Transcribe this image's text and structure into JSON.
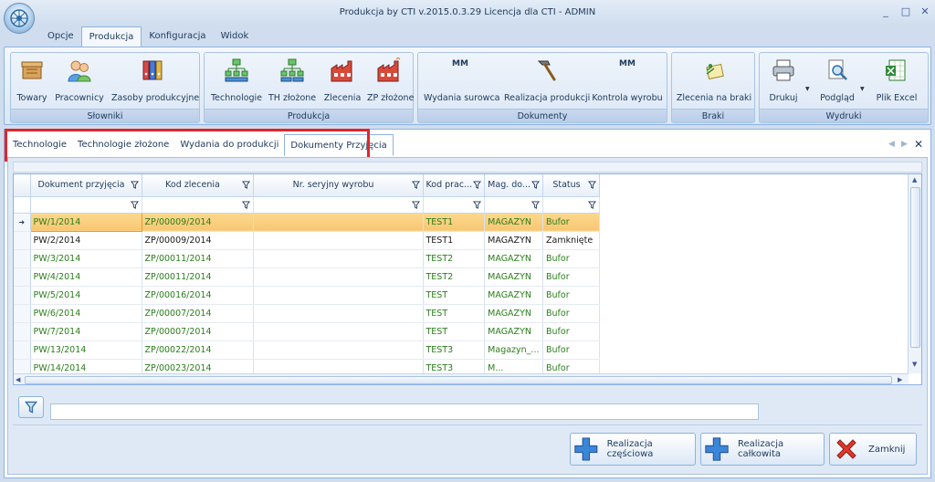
{
  "window": {
    "title": "Produkcja by CTI v.2015.0.3.29 Licencja dla CTI - ADMIN",
    "minimize_glyph": "_",
    "maximize_glyph": "□",
    "close_glyph": "✕"
  },
  "menu": {
    "tabs": [
      {
        "label": "Opcje"
      },
      {
        "label": "Produkcja"
      },
      {
        "label": "Konfiguracja"
      },
      {
        "label": "Widok"
      }
    ],
    "active": "Produkcja"
  },
  "ribbon": {
    "groups": [
      {
        "label": "Słowniki",
        "buttons": [
          {
            "label": "Towary",
            "icon": "box-icon"
          },
          {
            "label": "Pracownicy",
            "icon": "people-icon"
          },
          {
            "label": "Zasoby produkcyjne",
            "icon": "binders-icon"
          }
        ]
      },
      {
        "label": "Produkcja",
        "buttons": [
          {
            "label": "Technologie",
            "icon": "hierarchy-icon"
          },
          {
            "label": "TH złożone",
            "icon": "hierarchy-complex-icon"
          },
          {
            "label": "Zlecenia",
            "icon": "factory-icon"
          },
          {
            "label": "ZP złożone",
            "icon": "factory-complex-icon"
          }
        ]
      },
      {
        "label": "Dokumenty",
        "buttons": [
          {
            "label": "Wydania surowca",
            "icon": "mm-doc-icon"
          },
          {
            "label": "Realizacja produkcji",
            "icon": "hammer-icon"
          },
          {
            "label": "Kontrola wyrobu",
            "icon": "mm-doc-icon"
          }
        ]
      },
      {
        "label": "Braki",
        "buttons": [
          {
            "label": "Zlecenia na braki",
            "icon": "notes-icon"
          }
        ]
      },
      {
        "label": "Wydruki",
        "buttons": [
          {
            "label": "Drukuj",
            "icon": "printer-icon"
          },
          {
            "label": "Podgląd",
            "icon": "preview-icon"
          },
          {
            "label": "Plik Excel",
            "icon": "excel-icon"
          }
        ]
      }
    ],
    "mm_text": "MM"
  },
  "doc_tabs": {
    "tabs": [
      "Technologie",
      "Technologie złożone",
      "Wydania do produkcji",
      "Dokumenty Przyjęcia"
    ],
    "active": "Dokumenty Przyjęcia",
    "close_glyph": "✕",
    "highlight_color": "#e0262b"
  },
  "grid": {
    "columns": [
      "Dokument przyjęcia",
      "Kod zlecenia",
      "Nr. seryjny wyrobu",
      "Kod prac...",
      "Mag. do...",
      "Status"
    ],
    "rows": [
      {
        "doc": "PW/1/2014",
        "order": "ZP/00009/2014",
        "serial": "",
        "worker": "TEST1",
        "warehouse": "MAGAZYN",
        "status": "Bufor"
      },
      {
        "doc": "PW/2/2014",
        "order": "ZP/00009/2014",
        "serial": "",
        "worker": "TEST1",
        "warehouse": "MAGAZYN",
        "status": "Zamknięte"
      },
      {
        "doc": "PW/3/2014",
        "order": "ZP/00011/2014",
        "serial": "",
        "worker": "TEST2",
        "warehouse": "MAGAZYN",
        "status": "Bufor"
      },
      {
        "doc": "PW/4/2014",
        "order": "ZP/00011/2014",
        "serial": "",
        "worker": "TEST2",
        "warehouse": "MAGAZYN",
        "status": "Bufor"
      },
      {
        "doc": "PW/5/2014",
        "order": "ZP/00016/2014",
        "serial": "",
        "worker": "TEST",
        "warehouse": "MAGAZYN",
        "status": "Bufor"
      },
      {
        "doc": "PW/6/2014",
        "order": "ZP/00007/2014",
        "serial": "",
        "worker": "TEST",
        "warehouse": "MAGAZYN",
        "status": "Bufor"
      },
      {
        "doc": "PW/7/2014",
        "order": "ZP/00007/2014",
        "serial": "",
        "worker": "TEST",
        "warehouse": "MAGAZYN",
        "status": "Bufor"
      },
      {
        "doc": "PW/13/2014",
        "order": "ZP/00022/2014",
        "serial": "",
        "worker": "TEST3",
        "warehouse": "Magazyn_...",
        "status": "Bufor"
      },
      {
        "doc": "PW/14/2014",
        "order": "ZP/00023/2014",
        "serial": "",
        "worker": "TEST3",
        "warehouse": "M...",
        "status": "Bufor"
      }
    ],
    "selected_row_indicator": "➜",
    "text_color_green": "#2a7e1a",
    "selection_color": "#f8c672"
  },
  "filter_bar": {
    "value": ""
  },
  "actions": {
    "partial": "Realizacja częściowa",
    "full": "Realizacja całkowita",
    "close": "Zamknij"
  }
}
